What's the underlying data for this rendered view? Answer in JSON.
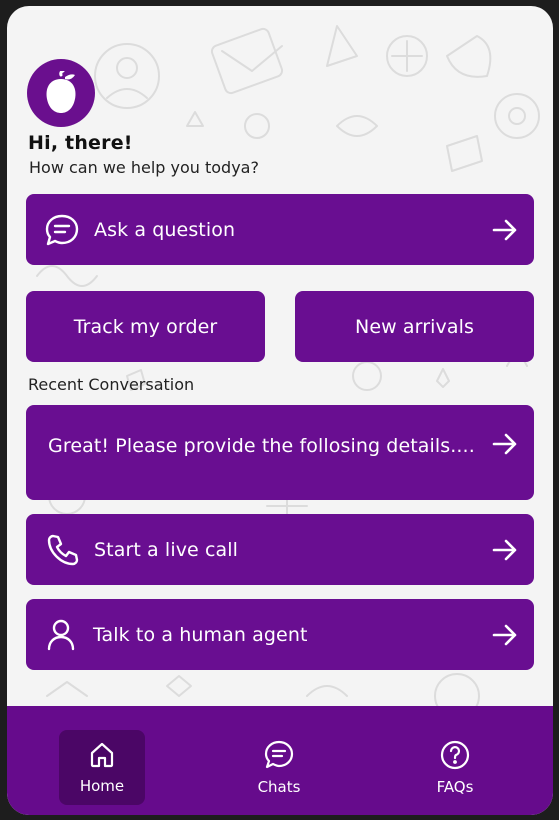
{
  "colors": {
    "primary": "#690e91",
    "nav_background": "#660b8c",
    "nav_active": "#4b0666",
    "page_background": "#f4f4f4"
  },
  "header": {
    "logo_icon": "acorn-icon",
    "greeting": "Hi, there!",
    "subtitle": "How can we help you todya?"
  },
  "actions": {
    "ask_question": {
      "label": "Ask a question",
      "icon": "chat-bubble-icon"
    },
    "track_order": {
      "label": "Track my order"
    },
    "new_arrivals": {
      "label": "New arrivals"
    }
  },
  "recent": {
    "title": "Recent Conversation",
    "last_message": "Great! Please provide the follosing details...."
  },
  "support": {
    "live_call": {
      "label": "Start a live call",
      "icon": "phone-icon"
    },
    "human_agent": {
      "label": "Talk to a human agent",
      "icon": "user-icon"
    }
  },
  "nav": {
    "items": [
      {
        "label": "Home",
        "icon": "home-icon",
        "active": true
      },
      {
        "label": "Chats",
        "icon": "chat-icon",
        "active": false
      },
      {
        "label": "FAQs",
        "icon": "help-circle-icon",
        "active": false
      }
    ]
  }
}
